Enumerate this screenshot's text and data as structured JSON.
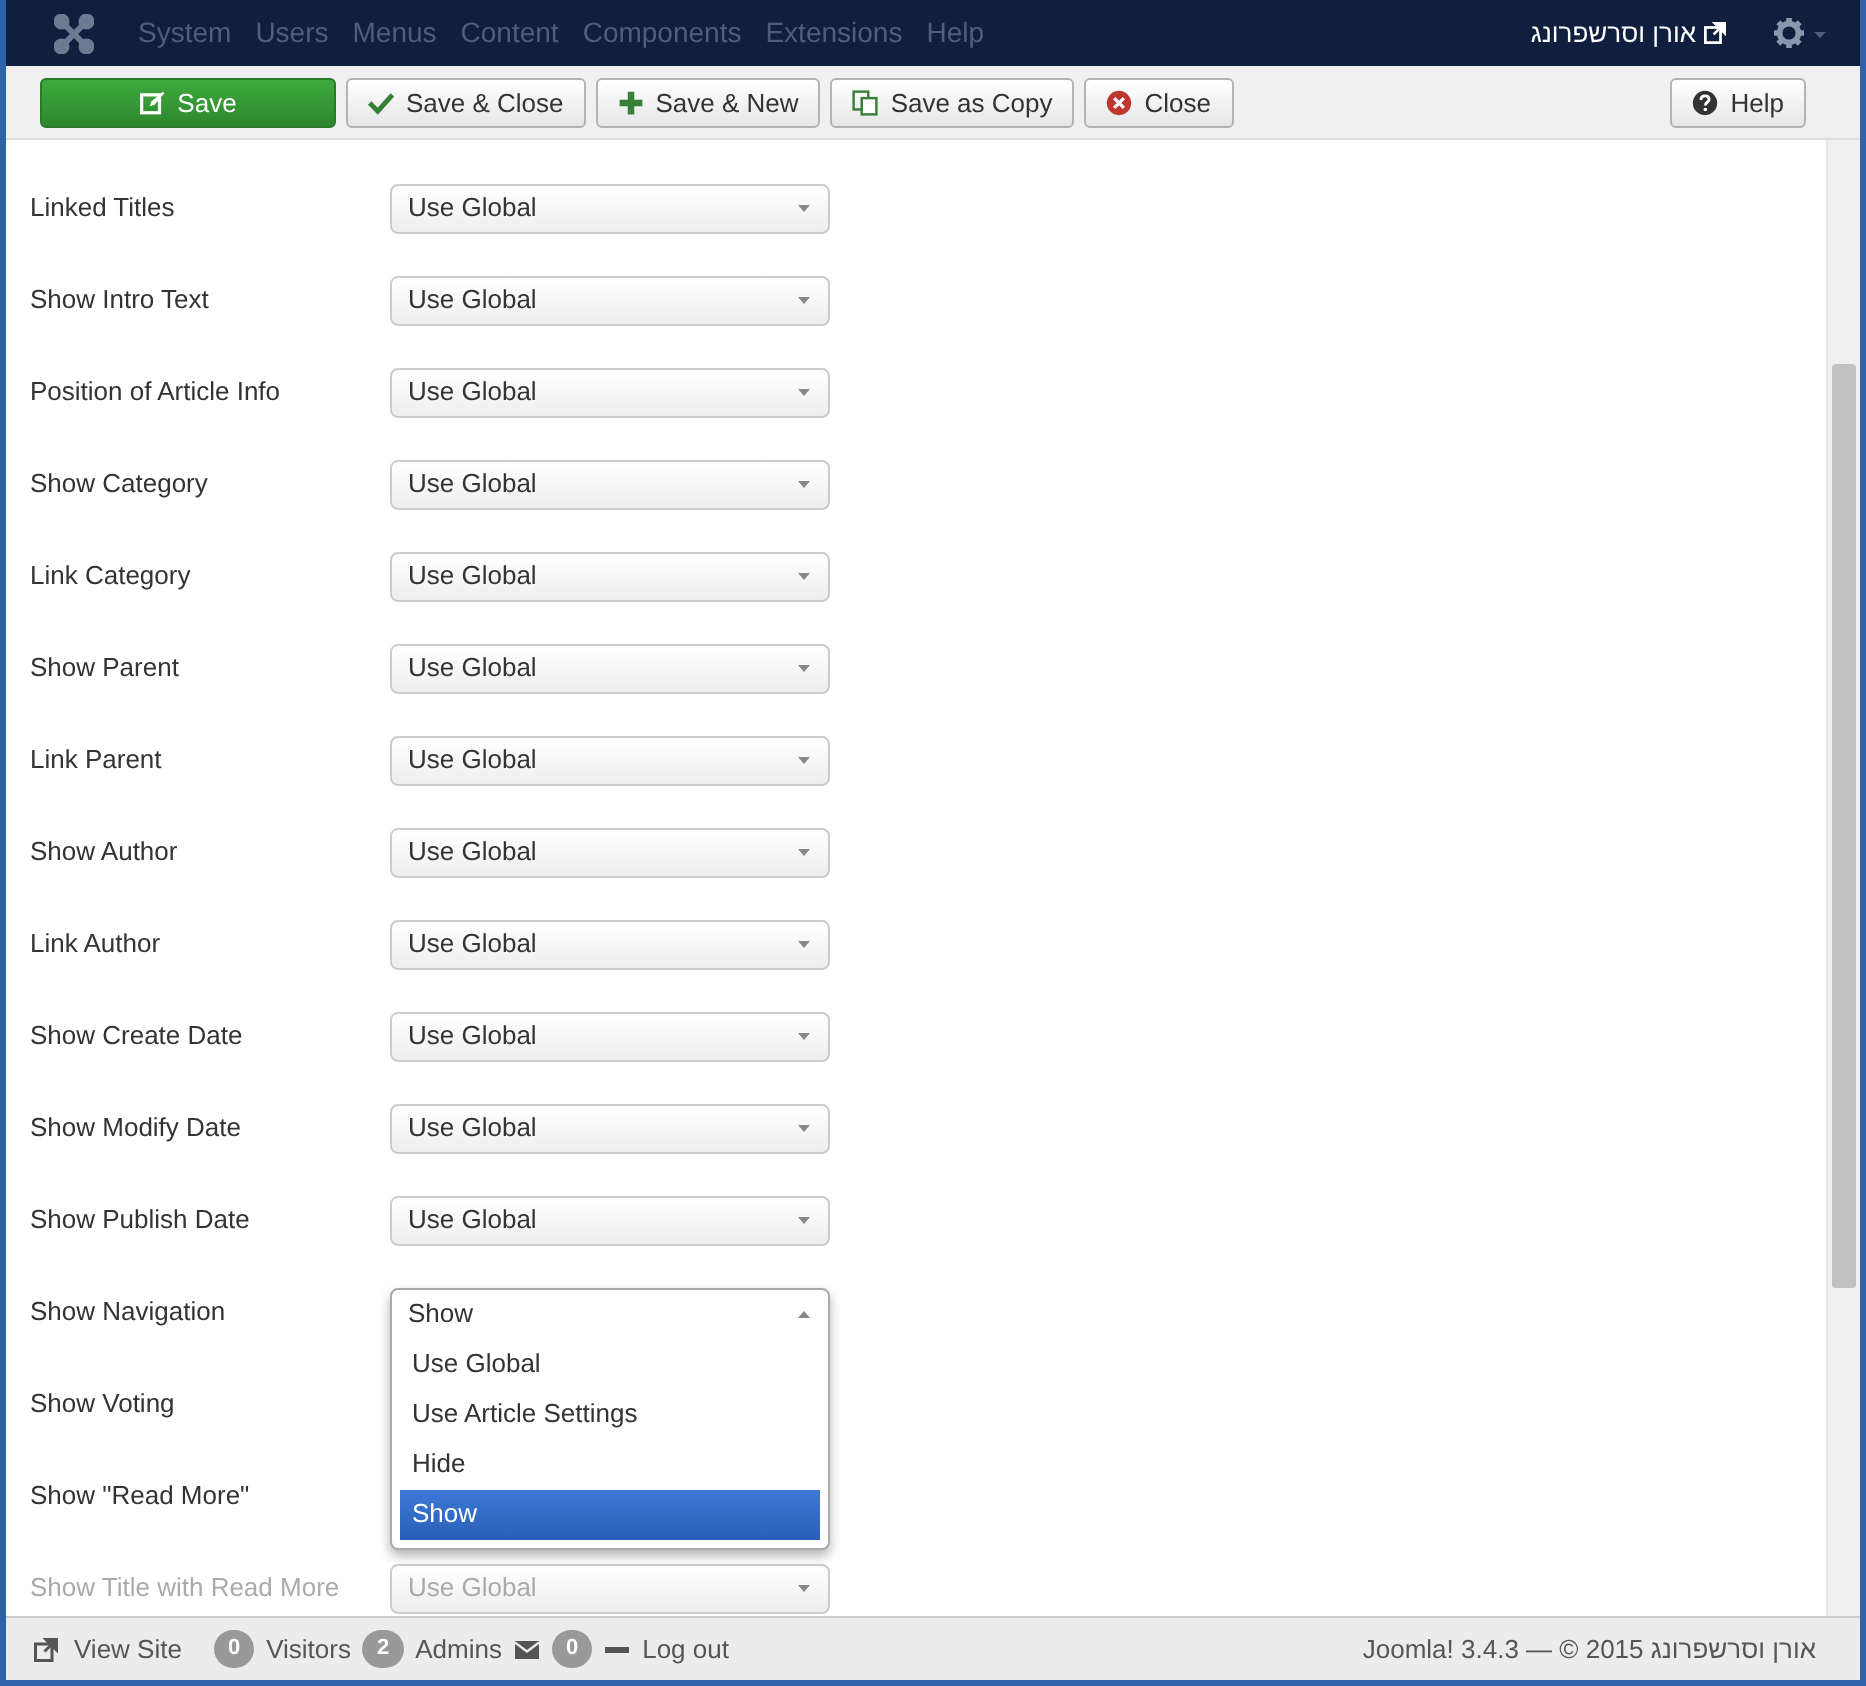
{
  "navbar": {
    "menu": [
      "System",
      "Users",
      "Menus",
      "Content",
      "Components",
      "Extensions",
      "Help"
    ],
    "user": "אורן וסרשפרונג"
  },
  "toolbar": [
    {
      "kind": "save",
      "label": "Save"
    },
    {
      "kind": "check",
      "label": "Save & Close"
    },
    {
      "kind": "plus",
      "label": "Save & New"
    },
    {
      "kind": "copy",
      "label": "Save as Copy"
    },
    {
      "kind": "close",
      "label": "Close"
    },
    {
      "kind": "help",
      "label": "Help"
    }
  ],
  "fields": [
    {
      "label": "Linked Titles",
      "value": "Use Global",
      "expanded": false,
      "dimmed": false
    },
    {
      "label": "Show Intro Text",
      "value": "Use Global",
      "expanded": false,
      "dimmed": false
    },
    {
      "label": "Position of Article Info",
      "value": "Use Global",
      "expanded": false,
      "dimmed": false
    },
    {
      "label": "Show Category",
      "value": "Use Global",
      "expanded": false,
      "dimmed": false
    },
    {
      "label": "Link Category",
      "value": "Use Global",
      "expanded": false,
      "dimmed": false
    },
    {
      "label": "Show Parent",
      "value": "Use Global",
      "expanded": false,
      "dimmed": false
    },
    {
      "label": "Link Parent",
      "value": "Use Global",
      "expanded": false,
      "dimmed": false
    },
    {
      "label": "Show Author",
      "value": "Use Global",
      "expanded": false,
      "dimmed": false
    },
    {
      "label": "Link Author",
      "value": "Use Global",
      "expanded": false,
      "dimmed": false
    },
    {
      "label": "Show Create Date",
      "value": "Use Global",
      "expanded": false,
      "dimmed": false
    },
    {
      "label": "Show Modify Date",
      "value": "Use Global",
      "expanded": false,
      "dimmed": false
    },
    {
      "label": "Show Publish Date",
      "value": "Use Global",
      "expanded": false,
      "dimmed": false
    },
    {
      "label": "Show Navigation",
      "value": "Show",
      "expanded": true,
      "dimmed": false,
      "options": [
        {
          "label": "Use Global",
          "selected": false
        },
        {
          "label": "Use Article Settings",
          "selected": false
        },
        {
          "label": "Hide",
          "selected": false
        },
        {
          "label": "Show",
          "selected": true
        }
      ]
    },
    {
      "label": "Show Voting",
      "expanded": false,
      "dimmed": false
    },
    {
      "label": "Show \"Read More\"",
      "expanded": false,
      "dimmed": false
    },
    {
      "label": "Show Title with Read More",
      "value": "Use Global",
      "expanded": false,
      "dimmed": true
    }
  ],
  "status_bar": {
    "view_site": "View Site",
    "visitors_count": "0",
    "visitors": "Visitors",
    "admins_count": "2",
    "admins": "Admins",
    "messages_count": "0",
    "logout": "Log out",
    "copyright": "Joomla! 3.4.3 — © 2015 אורן וסרשפרונג"
  }
}
